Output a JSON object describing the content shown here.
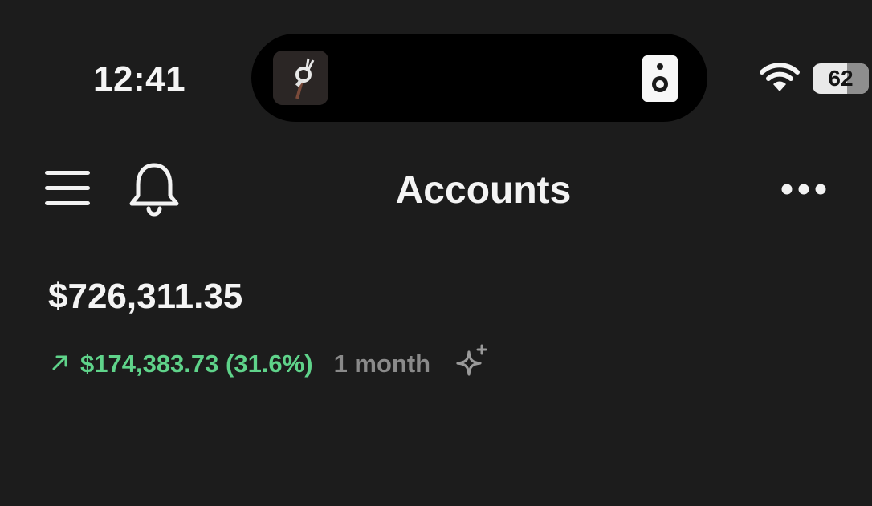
{
  "status_bar": {
    "time": "12:41",
    "battery_level": "62",
    "battery_fraction": 0.62,
    "wifi_icon": "wifi-icon",
    "dynamic_island": {
      "album_art_icon": "ok-hand-album-art",
      "speaker_icon": "speaker-icon"
    }
  },
  "nav": {
    "menu_icon": "hamburger-menu-icon",
    "bell_icon": "bell-icon",
    "title": "Accounts",
    "more_icon": "more-horizontal-icon"
  },
  "portfolio": {
    "balance": "$726,311.35",
    "change_arrow_icon": "arrow-up-right-icon",
    "change": "$174,383.73 (31.6%)",
    "period": "1 month",
    "insights_icon": "sparkle-icon"
  },
  "colors": {
    "background": "#1c1c1c",
    "text": "#f4f4f4",
    "positive": "#5fd38a",
    "muted": "#8a8a8a"
  }
}
